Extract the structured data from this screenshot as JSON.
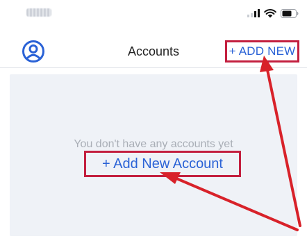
{
  "header": {
    "title": "Accounts",
    "profile_icon": "user-circle-icon",
    "add_new_label": "+ ADD NEW"
  },
  "status_bar": {
    "icons": [
      "signal-icon",
      "wifi-icon",
      "battery-icon"
    ]
  },
  "empty_state": {
    "message": "You don't have any accounts yet",
    "add_account_label": "+ Add New Account"
  },
  "colors": {
    "accent": "#2a62d6",
    "annotation": "#c31f3f",
    "panel_bg": "#eff2f7",
    "muted_text": "#a9aeb6"
  }
}
